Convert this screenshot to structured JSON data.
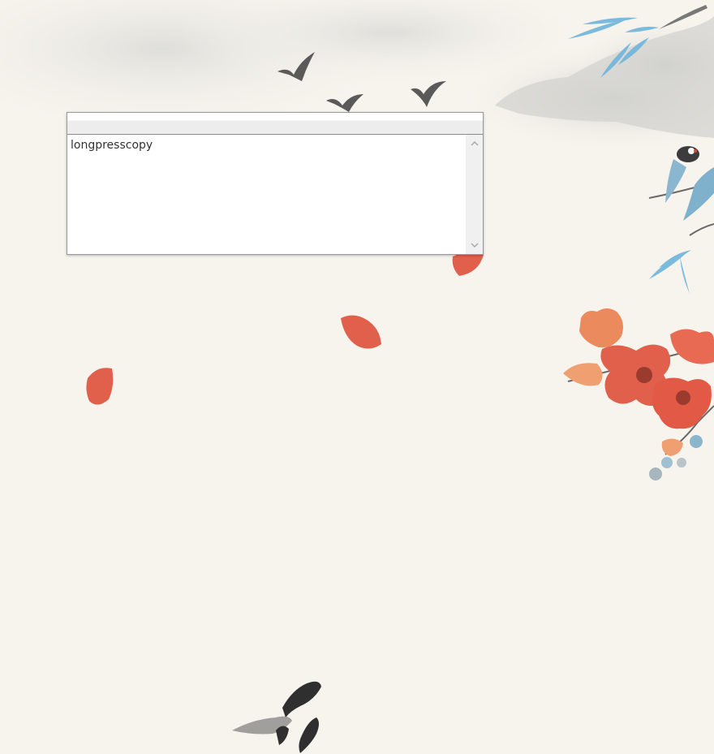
{
  "editor": {
    "title": "",
    "content": "longpresscopy"
  },
  "scrollbar": {
    "up_icon": "chevron-up-icon",
    "down_icon": "chevron-down-icon"
  },
  "colors": {
    "background": "#f7f4ee",
    "petal": "#e0604c",
    "ink": "#3a3a3a",
    "bamboo": "#6fb4dc"
  }
}
